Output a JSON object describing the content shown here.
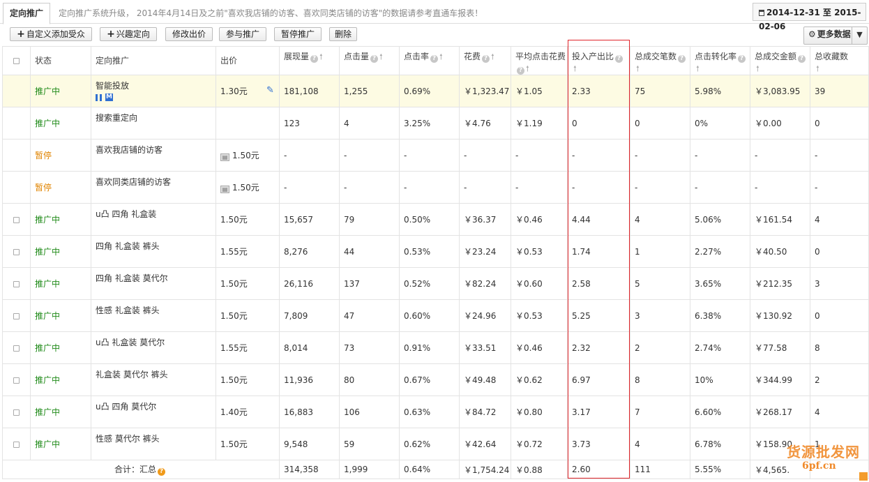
{
  "tab": {
    "label": "定向推广"
  },
  "notice": "定向推广系统升级， 2014年4月14日及之前\"喜欢我店铺的访客、喜欢同类店铺的访客\"的数据请参考直通车报表！",
  "date_range": "2014-12-31 至 2015-02-06",
  "toolbar": {
    "buttons": [
      {
        "label": "自定义添加受众",
        "plus": true
      },
      {
        "label": "兴趣定向",
        "plus": true
      },
      {
        "label": "修改出价",
        "plus": false
      },
      {
        "label": "参与推广",
        "plus": false
      },
      {
        "label": "暂停推广",
        "plus": false
      },
      {
        "label": "删除",
        "plus": false
      }
    ],
    "more_label": "更多数据"
  },
  "columns": {
    "status": "状态",
    "target": "定向推广",
    "bid": "出价",
    "impressions": "展现量",
    "clicks": "点击量",
    "ctr": "点击率",
    "cost": "花费",
    "avg_cpc": "平均点击花费",
    "roi": "投入产出比",
    "orders": "总成交笔数",
    "cvr": "点击转化率",
    "gmv": "总成交金额",
    "favs": "总收藏数"
  },
  "rows": [
    {
      "checkbox": false,
      "status": "推广中",
      "status_type": "run",
      "name": "智能投放",
      "icons": true,
      "bid": "1.30元",
      "bid_icon": false,
      "editable": true,
      "impressions": "181,108",
      "clicks": "1,255",
      "ctr": "0.69%",
      "cost": "￥1,323.47",
      "avg_cpc": "￥1.05",
      "roi": "2.33",
      "orders": "75",
      "cvr": "5.98%",
      "gmv": "￥3,083.95",
      "favs": "39",
      "highlight": true
    },
    {
      "checkbox": false,
      "status": "推广中",
      "status_type": "run",
      "name": "搜索重定向",
      "icons": false,
      "bid": "",
      "bid_icon": false,
      "editable": false,
      "impressions": "123",
      "clicks": "4",
      "ctr": "3.25%",
      "cost": "￥4.76",
      "avg_cpc": "￥1.19",
      "roi": "0",
      "orders": "0",
      "cvr": "0%",
      "gmv": "￥0.00",
      "favs": "0",
      "highlight": false
    },
    {
      "checkbox": false,
      "status": "暂停",
      "status_type": "pause",
      "name": "喜欢我店铺的访客",
      "icons": false,
      "bid": "1.50元",
      "bid_icon": true,
      "editable": false,
      "impressions": "-",
      "clicks": "-",
      "ctr": "-",
      "cost": "-",
      "avg_cpc": "-",
      "roi": "-",
      "orders": "-",
      "cvr": "-",
      "gmv": "-",
      "favs": "-",
      "highlight": false
    },
    {
      "checkbox": false,
      "status": "暂停",
      "status_type": "pause",
      "name": "喜欢同类店铺的访客",
      "icons": false,
      "bid": "1.50元",
      "bid_icon": true,
      "editable": false,
      "impressions": "-",
      "clicks": "-",
      "ctr": "-",
      "cost": "-",
      "avg_cpc": "-",
      "roi": "-",
      "orders": "-",
      "cvr": "-",
      "gmv": "-",
      "favs": "-",
      "highlight": false
    },
    {
      "checkbox": true,
      "status": "推广中",
      "status_type": "run",
      "name": "u凸 四角 礼盒装",
      "icons": false,
      "bid": "1.50元",
      "bid_icon": false,
      "editable": false,
      "impressions": "15,657",
      "clicks": "79",
      "ctr": "0.50%",
      "cost": "￥36.37",
      "avg_cpc": "￥0.46",
      "roi": "4.44",
      "orders": "4",
      "cvr": "5.06%",
      "gmv": "￥161.54",
      "favs": "4",
      "highlight": false
    },
    {
      "checkbox": true,
      "status": "推广中",
      "status_type": "run",
      "name": "四角 礼盒装 裤头",
      "icons": false,
      "bid": "1.55元",
      "bid_icon": false,
      "editable": false,
      "impressions": "8,276",
      "clicks": "44",
      "ctr": "0.53%",
      "cost": "￥23.24",
      "avg_cpc": "￥0.53",
      "roi": "1.74",
      "orders": "1",
      "cvr": "2.27%",
      "gmv": "￥40.50",
      "favs": "0",
      "highlight": false
    },
    {
      "checkbox": true,
      "status": "推广中",
      "status_type": "run",
      "name": "四角 礼盒装 莫代尔",
      "icons": false,
      "bid": "1.50元",
      "bid_icon": false,
      "editable": false,
      "impressions": "26,116",
      "clicks": "137",
      "ctr": "0.52%",
      "cost": "￥82.24",
      "avg_cpc": "￥0.60",
      "roi": "2.58",
      "orders": "5",
      "cvr": "3.65%",
      "gmv": "￥212.35",
      "favs": "3",
      "highlight": false
    },
    {
      "checkbox": true,
      "status": "推广中",
      "status_type": "run",
      "name": "性感 礼盒装 裤头",
      "icons": false,
      "bid": "1.50元",
      "bid_icon": false,
      "editable": false,
      "impressions": "7,809",
      "clicks": "47",
      "ctr": "0.60%",
      "cost": "￥24.96",
      "avg_cpc": "￥0.53",
      "roi": "5.25",
      "orders": "3",
      "cvr": "6.38%",
      "gmv": "￥130.92",
      "favs": "0",
      "highlight": false
    },
    {
      "checkbox": true,
      "status": "推广中",
      "status_type": "run",
      "name": "u凸 礼盒装 莫代尔",
      "icons": false,
      "bid": "1.55元",
      "bid_icon": false,
      "editable": false,
      "impressions": "8,014",
      "clicks": "73",
      "ctr": "0.91%",
      "cost": "￥33.51",
      "avg_cpc": "￥0.46",
      "roi": "2.32",
      "orders": "2",
      "cvr": "2.74%",
      "gmv": "￥77.58",
      "favs": "8",
      "highlight": false
    },
    {
      "checkbox": true,
      "status": "推广中",
      "status_type": "run",
      "name": "礼盒装 莫代尔 裤头",
      "icons": false,
      "bid": "1.50元",
      "bid_icon": false,
      "editable": false,
      "impressions": "11,936",
      "clicks": "80",
      "ctr": "0.67%",
      "cost": "￥49.48",
      "avg_cpc": "￥0.62",
      "roi": "6.97",
      "orders": "8",
      "cvr": "10%",
      "gmv": "￥344.99",
      "favs": "2",
      "highlight": false
    },
    {
      "checkbox": true,
      "status": "推广中",
      "status_type": "run",
      "name": "u凸 四角 莫代尔",
      "icons": false,
      "bid": "1.40元",
      "bid_icon": false,
      "editable": false,
      "impressions": "16,883",
      "clicks": "106",
      "ctr": "0.63%",
      "cost": "￥84.72",
      "avg_cpc": "￥0.80",
      "roi": "3.17",
      "orders": "7",
      "cvr": "6.60%",
      "gmv": "￥268.17",
      "favs": "4",
      "highlight": false
    },
    {
      "checkbox": true,
      "status": "推广中",
      "status_type": "run",
      "name": "性感 莫代尔 裤头",
      "icons": false,
      "bid": "1.50元",
      "bid_icon": false,
      "editable": false,
      "impressions": "9,548",
      "clicks": "59",
      "ctr": "0.62%",
      "cost": "￥42.64",
      "avg_cpc": "￥0.72",
      "roi": "3.73",
      "orders": "4",
      "cvr": "6.78%",
      "gmv": "￥158.90",
      "favs": "1",
      "highlight": false
    }
  ],
  "totals": {
    "label": "合计：汇总",
    "impressions": "314,358",
    "clicks": "1,999",
    "ctr": "0.64%",
    "cost": "￥1,754.24",
    "avg_cpc": "￥0.88",
    "roi": "2.60",
    "orders": "111",
    "cvr": "5.55%",
    "gmv": "￥4,565.",
    "favs": ""
  },
  "watermark": {
    "main": "货源批发网",
    "sub": "6pf.cn"
  },
  "colors": {
    "running": "#1f8a18",
    "paused": "#e08400",
    "highlight_row": "#fdfbe3",
    "roi_outline": "#e0242a"
  }
}
